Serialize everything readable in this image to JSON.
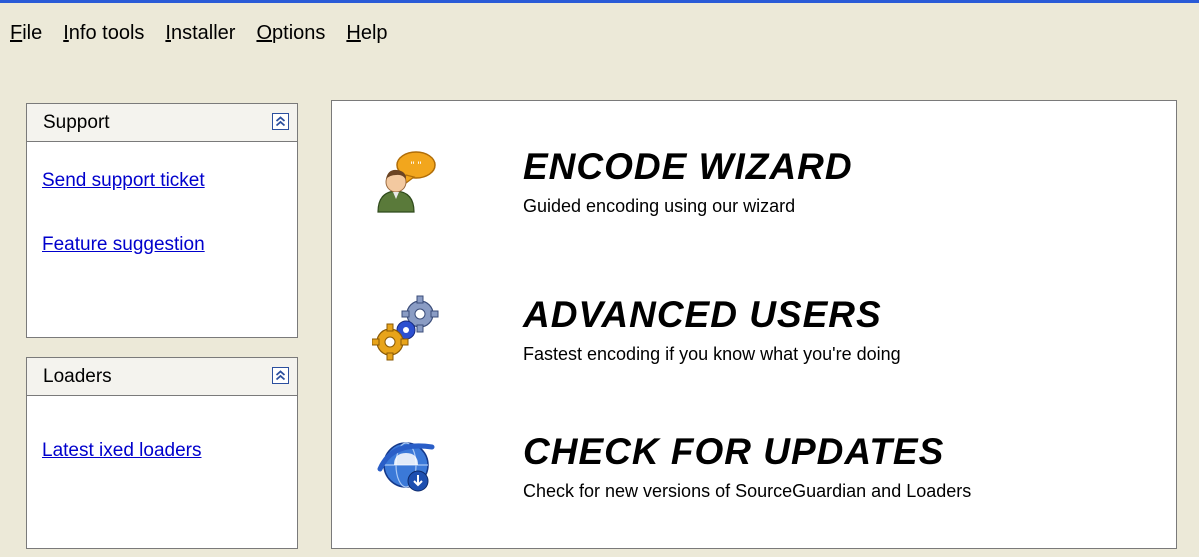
{
  "menu": {
    "items": [
      {
        "underline": "F",
        "rest": "ile"
      },
      {
        "underline": "I",
        "rest": "nfo tools"
      },
      {
        "underline": "I",
        "rest": "nstaller",
        "pre": ""
      },
      {
        "underline": "O",
        "rest": "ptions"
      },
      {
        "underline": "H",
        "rest": "elp"
      }
    ]
  },
  "support": {
    "title": "Support",
    "links": [
      "Send support ticket",
      "Feature suggestion"
    ]
  },
  "loaders": {
    "title": "Loaders",
    "links": [
      "Latest ixed loaders"
    ]
  },
  "actions": [
    {
      "title": "ENCODE WIZARD",
      "subtitle": "Guided encoding using our wizard",
      "icon": "wizard-person-speech-icon"
    },
    {
      "title": "ADVANCED USERS",
      "subtitle": "Fastest encoding if you know what you're doing",
      "icon": "gears-icon"
    },
    {
      "title": "CHECK FOR UPDATES",
      "subtitle": "Check for new versions of SourceGuardian and Loaders",
      "icon": "globe-update-icon"
    }
  ],
  "colors": {
    "background": "#ece9d8",
    "link": "#0000cc",
    "window_border": "#2a5bd7"
  }
}
